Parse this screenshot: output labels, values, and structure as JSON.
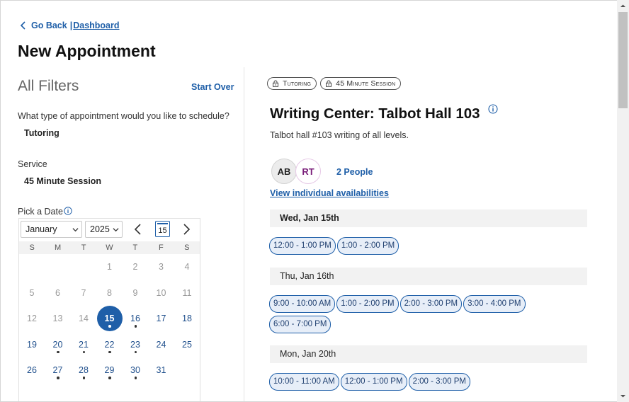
{
  "header": {
    "back_label": "Go Back",
    "separator": "|",
    "dashboard_label": "Dashboard",
    "title": "New Appointment"
  },
  "filters": {
    "title": "All Filters",
    "start_over": "Start Over",
    "question_type": "What type of appointment would you like to schedule?",
    "type_value": "Tutoring",
    "service_label": "Service",
    "service_value": "45 Minute Session",
    "date_label": "Pick a Date"
  },
  "calendar": {
    "month": "January",
    "year": "2025",
    "today_day": "15",
    "weekdays": [
      "S",
      "M",
      "T",
      "W",
      "T",
      "F",
      "S"
    ],
    "weeks": [
      [
        null,
        null,
        null,
        {
          "d": "1",
          "s": "disabled"
        },
        {
          "d": "2",
          "s": "disabled"
        },
        {
          "d": "3",
          "s": "disabled"
        },
        {
          "d": "4",
          "s": "disabled"
        }
      ],
      [
        {
          "d": "5",
          "s": "disabled"
        },
        {
          "d": "6",
          "s": "disabled"
        },
        {
          "d": "7",
          "s": "disabled"
        },
        {
          "d": "8",
          "s": "disabled"
        },
        {
          "d": "9",
          "s": "disabled"
        },
        {
          "d": "10",
          "s": "disabled"
        },
        {
          "d": "11",
          "s": "disabled"
        }
      ],
      [
        {
          "d": "12",
          "s": "disabled"
        },
        {
          "d": "13",
          "s": "disabled"
        },
        {
          "d": "14",
          "s": "disabled"
        },
        {
          "d": "15",
          "s": "selected",
          "dot": true
        },
        {
          "d": "16",
          "s": "avail",
          "dot": true
        },
        {
          "d": "17",
          "s": "avail"
        },
        {
          "d": "18",
          "s": "avail"
        }
      ],
      [
        {
          "d": "19",
          "s": "avail"
        },
        {
          "d": "20",
          "s": "avail",
          "dot": true
        },
        {
          "d": "21",
          "s": "avail",
          "dot": true
        },
        {
          "d": "22",
          "s": "avail",
          "dot": true
        },
        {
          "d": "23",
          "s": "avail",
          "dot": true
        },
        {
          "d": "24",
          "s": "avail"
        },
        {
          "d": "25",
          "s": "avail"
        }
      ],
      [
        {
          "d": "26",
          "s": "avail"
        },
        {
          "d": "27",
          "s": "avail",
          "dot": true
        },
        {
          "d": "28",
          "s": "avail",
          "dot": true
        },
        {
          "d": "29",
          "s": "avail",
          "dot": true
        },
        {
          "d": "30",
          "s": "avail",
          "dot": true
        },
        {
          "d": "31",
          "s": "avail"
        },
        null
      ]
    ]
  },
  "appointment": {
    "chips": [
      "Tutoring",
      "45 Minute Session"
    ],
    "location_title": "Writing Center: Talbot Hall 103",
    "location_desc": "Talbot hall #103 writing of all levels.",
    "avatars": [
      "AB",
      "RT"
    ],
    "people_label": "2 People",
    "view_availabilities": "View individual availabilities",
    "days": [
      {
        "label": "Wed, Jan 15th",
        "bold": true,
        "slots": [
          "12:00 - 1:00 PM",
          "1:00 - 2:00 PM"
        ]
      },
      {
        "label": "Thu, Jan 16th",
        "bold": false,
        "slots": [
          "9:00 - 10:00 AM",
          "1:00 - 2:00 PM",
          "2:00 - 3:00 PM",
          "3:00 - 4:00 PM",
          "6:00 - 7:00 PM"
        ]
      },
      {
        "label": "Mon, Jan 20th",
        "bold": false,
        "slots": [
          "10:00 - 11:00 AM",
          "12:00 - 1:00 PM",
          "2:00 - 3:00 PM"
        ]
      }
    ]
  },
  "colors": {
    "accent": "#1f5fa8",
    "slot_bg": "#e7eef8",
    "header_bg": "#f2f2f2"
  }
}
